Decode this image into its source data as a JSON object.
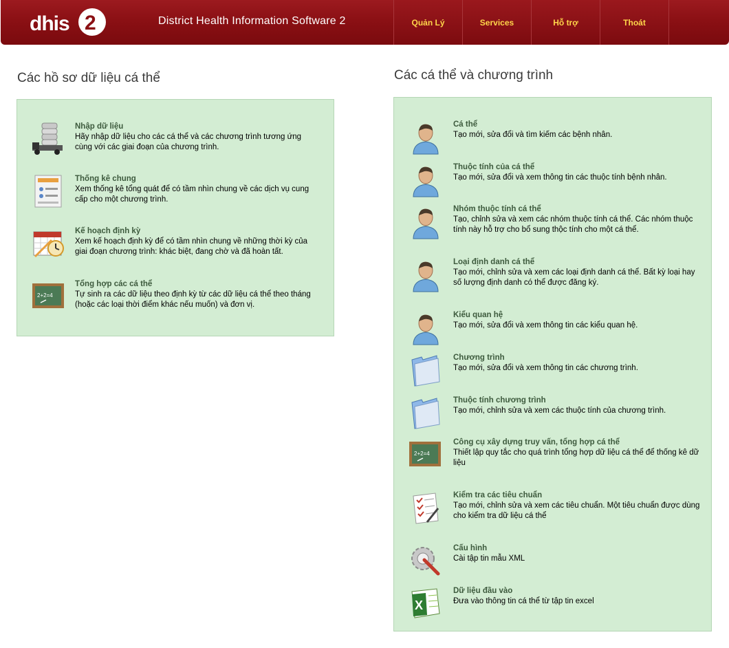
{
  "header": {
    "logo_text": "dhis2",
    "title": "District Health Information Software 2",
    "menu": [
      "Quản Lý",
      "Services",
      "Hỗ trợ",
      "Thoát"
    ]
  },
  "left": {
    "title": "Các hồ sơ dữ liệu cá thể",
    "items": [
      {
        "title": "Nhập dữ liệu",
        "desc": "Hãy nhập dữ liệu cho các cá thể và các chương trình tương ứng cùng với các giai đoạn của chương trình.",
        "icon": "database-truck-icon"
      },
      {
        "title": "Thống kê chung",
        "desc": "Xem thống kê tổng quát để có tầm nhìn chung về các dịch vụ cung cấp cho một chương trình.",
        "icon": "report-icon"
      },
      {
        "title": "Kế hoạch định kỳ",
        "desc": "Xem kế hoạch định kỳ để có tầm nhìn chung về những thời kỳ của giai đoạn chương trình: khác biệt, đang chờ và đã hoàn tất.",
        "icon": "calendar-clock-icon"
      },
      {
        "title": "Tổng hợp các cá thể",
        "desc": "Tự sinh ra các dữ liệu theo định kỳ từ các dữ liệu cá thể theo tháng (hoặc các loại thời điểm khác nếu muốn) và đơn vị.",
        "icon": "chalkboard-icon"
      }
    ]
  },
  "right": {
    "title": "Các cá thể và chương trình",
    "items": [
      {
        "title": "Cá thể",
        "desc": "Tạo mới, sửa đổi và tìm kiếm các bệnh nhân.",
        "icon": "person-icon"
      },
      {
        "title": "Thuộc tính của cá thể",
        "desc": "Tạo mới, sửa đổi và xem thông tin các thuộc tính bệnh nhân.",
        "icon": "person-icon"
      },
      {
        "title": "Nhóm thuộc tính cá thể",
        "desc": "Tạo, chỉnh sửa và xem các nhóm thuộc tính cá thể. Các nhóm thuộc tính này hỗ trợ cho bổ sung thộc tính cho một cá thể.",
        "icon": "person-icon"
      },
      {
        "title": "Loại định danh cá thể",
        "desc": "Tạo mới, chỉnh sửa và xem các loại định danh cá thể. Bất kỳ loại hay số lượng định danh có thể được đăng ký.",
        "icon": "person-icon"
      },
      {
        "title": "Kiểu quan hệ",
        "desc": "Tạo mới, sửa đổi và xem thông tin các kiểu quan hệ.",
        "icon": "person-icon"
      },
      {
        "title": "Chương trình",
        "desc": "Tạo mới, sửa đổi và xem thông tin các chương trình.",
        "icon": "folder-icon"
      },
      {
        "title": "Thuộc tính chương trình",
        "desc": "Tạo mới, chỉnh sửa và xem các thuộc tính của chương trình.",
        "icon": "folder-icon"
      },
      {
        "title": "Công cụ xây dựng truy vấn, tổng hợp cá thể",
        "desc": "Thiết lập quy tắc cho quá trình tổng hợp dữ liệu cá thể để thống kê dữ liệu",
        "icon": "chalkboard-icon"
      },
      {
        "title": "Kiểm tra các tiêu chuẩn",
        "desc": "Tạo mới, chỉnh sửa và xem các tiêu chuẩn. Một tiêu chuẩn được dùng cho kiểm tra dữ liệu cá thể",
        "icon": "checklist-icon"
      },
      {
        "title": "Cấu hình",
        "desc": "Cài tập tin mẫu XML",
        "icon": "gear-wrench-icon"
      },
      {
        "title": "Dữ liệu đầu vào",
        "desc": "Đưa vào thông tin cá thể từ tập tin excel",
        "icon": "excel-icon"
      }
    ]
  }
}
